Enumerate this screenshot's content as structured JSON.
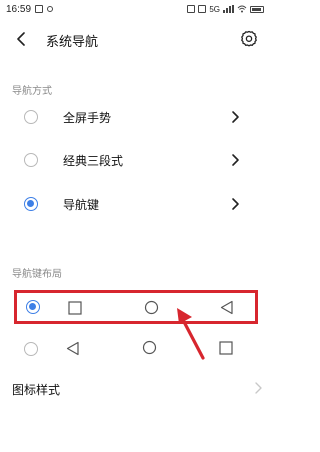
{
  "status_bar": {
    "time": "16:59",
    "icons": [
      "message-icon",
      "dot-icon",
      "dot-icon"
    ],
    "right_icons": [
      "nfc-icon",
      "hd-icon",
      "signal-icon",
      "wifi-icon",
      "battery-icon"
    ],
    "net_label": "5G"
  },
  "header": {
    "title": "系统导航",
    "back_icon": "back-arrow-icon",
    "settings_icon": "gear-icon"
  },
  "navigation_mode": {
    "section_label": "导航方式",
    "options": [
      {
        "label": "全屏手势",
        "selected": false
      },
      {
        "label": "经典三段式",
        "selected": false
      },
      {
        "label": "导航键",
        "selected": true
      }
    ]
  },
  "key_layout": {
    "section_label": "导航键布局",
    "options": [
      {
        "selected": true,
        "icons": [
          "square-icon",
          "circle-icon",
          "triangle-left-icon"
        ],
        "highlighted": true
      },
      {
        "selected": false,
        "icons": [
          "triangle-left-icon",
          "circle-icon",
          "square-icon"
        ],
        "highlighted": false
      }
    ]
  },
  "icon_style": {
    "label": "图标样式"
  },
  "colors": {
    "accent": "#3d7fe6",
    "highlight": "#d7262e",
    "section_text": "#8a8a8a"
  }
}
